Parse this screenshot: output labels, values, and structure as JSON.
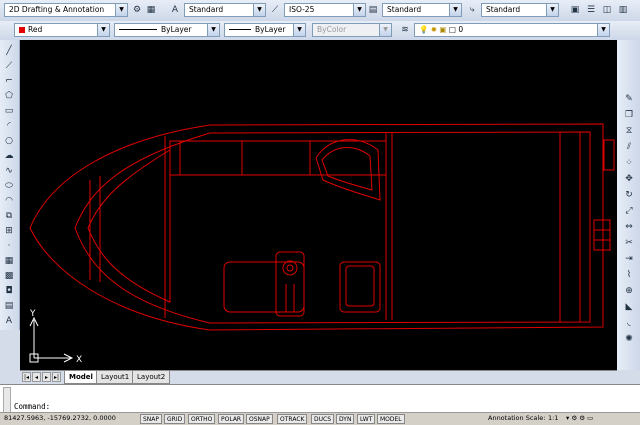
{
  "toolbar1": {
    "workspace": "2D Drafting & Annotation",
    "text_style": "Standard",
    "dim_style": "ISO-25",
    "table_style": "Standard",
    "mleader_style": "Standard"
  },
  "toolbar2": {
    "color": "Red",
    "linetype": "ByLayer",
    "lineweight": "ByLayer",
    "plotstyle": "ByColor",
    "layer": "0"
  },
  "colors": {
    "drawing": "#e00000",
    "canvas": "#000000",
    "ucs": "#ffffff"
  },
  "ucs": {
    "x_label": "X",
    "y_label": "Y"
  },
  "tabs": {
    "model": "Model",
    "layout1": "Layout1",
    "layout2": "Layout2"
  },
  "command": {
    "prompt": "Command:"
  },
  "status": {
    "coords": "81427.5963, -15769.2732, 0.0000",
    "snap": "SNAP",
    "grid": "GRID",
    "ortho": "ORTHO",
    "polar": "POLAR",
    "osnap": "OSNAP",
    "otrack": "OTRACK",
    "ducs": "DUCS",
    "dyn": "DYN",
    "lwt": "LWT",
    "model": "MODEL",
    "annotation_scale_label": "Annotation Scale:",
    "annotation_scale": "1:1"
  },
  "icons": {
    "left": [
      "line-icon",
      "construction-line-icon",
      "polyline-icon",
      "polygon-icon",
      "rectangle-icon",
      "arc-icon",
      "circle-icon",
      "revision-cloud-icon",
      "spline-icon",
      "ellipse-icon",
      "ellipse-arc-icon",
      "insert-block-icon",
      "make-block-icon",
      "point-icon",
      "hatch-icon",
      "gradient-icon",
      "region-icon",
      "table-icon",
      "multiline-text-icon"
    ],
    "right": [
      "erase-icon",
      "copy-icon",
      "mirror-icon",
      "offset-icon",
      "array-icon",
      "move-icon",
      "rotate-icon",
      "scale-icon",
      "stretch-icon",
      "trim-icon",
      "extend-icon",
      "break-icon",
      "join-icon",
      "chamfer-icon",
      "fillet-icon",
      "explode-icon"
    ]
  }
}
